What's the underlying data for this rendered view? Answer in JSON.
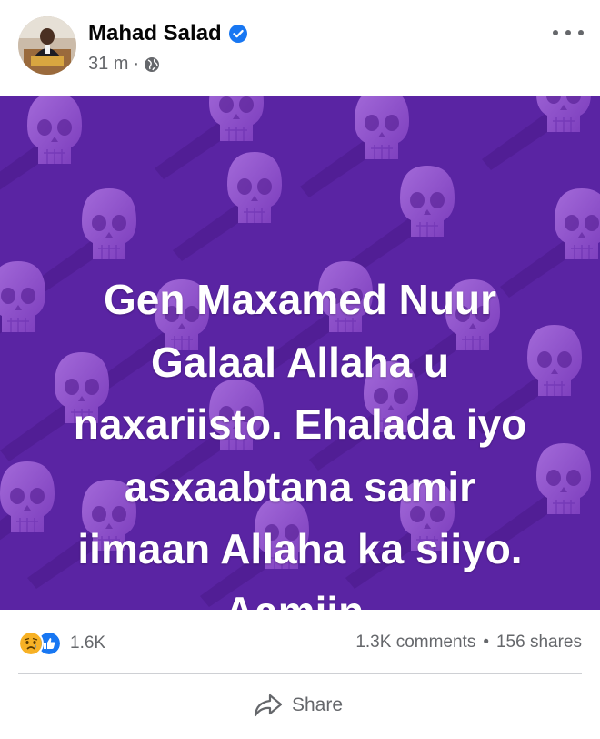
{
  "post": {
    "author": "Mahad Salad",
    "time": "31 m",
    "dot": "·",
    "privacy_icon": "globe-icon",
    "verified_icon": "verified-badge-icon",
    "more_icon": "more-options-icon"
  },
  "image": {
    "text_lines": [
      "Gen Maxamed Nuur",
      "Galaal Allaha u",
      "naxariisto. Ehalada iyo",
      "asxaabtana samir",
      "iimaan Allaha ka siiyo.",
      "Aamiin."
    ],
    "background_color": "#5a24a3",
    "pattern": "skulls"
  },
  "stats": {
    "reactions": [
      "sad-reaction-icon",
      "like-reaction-icon"
    ],
    "reaction_count": "1.6K",
    "comments": "1.3K comments",
    "dot": "•",
    "shares": "156 shares"
  },
  "actions": {
    "share_label": "Share",
    "share_icon": "share-arrow-icon"
  },
  "colors": {
    "accent_blue": "#1877f2",
    "muted_text": "#65676b",
    "purple": "#5a24a3",
    "skull": "#8d4fc9"
  }
}
